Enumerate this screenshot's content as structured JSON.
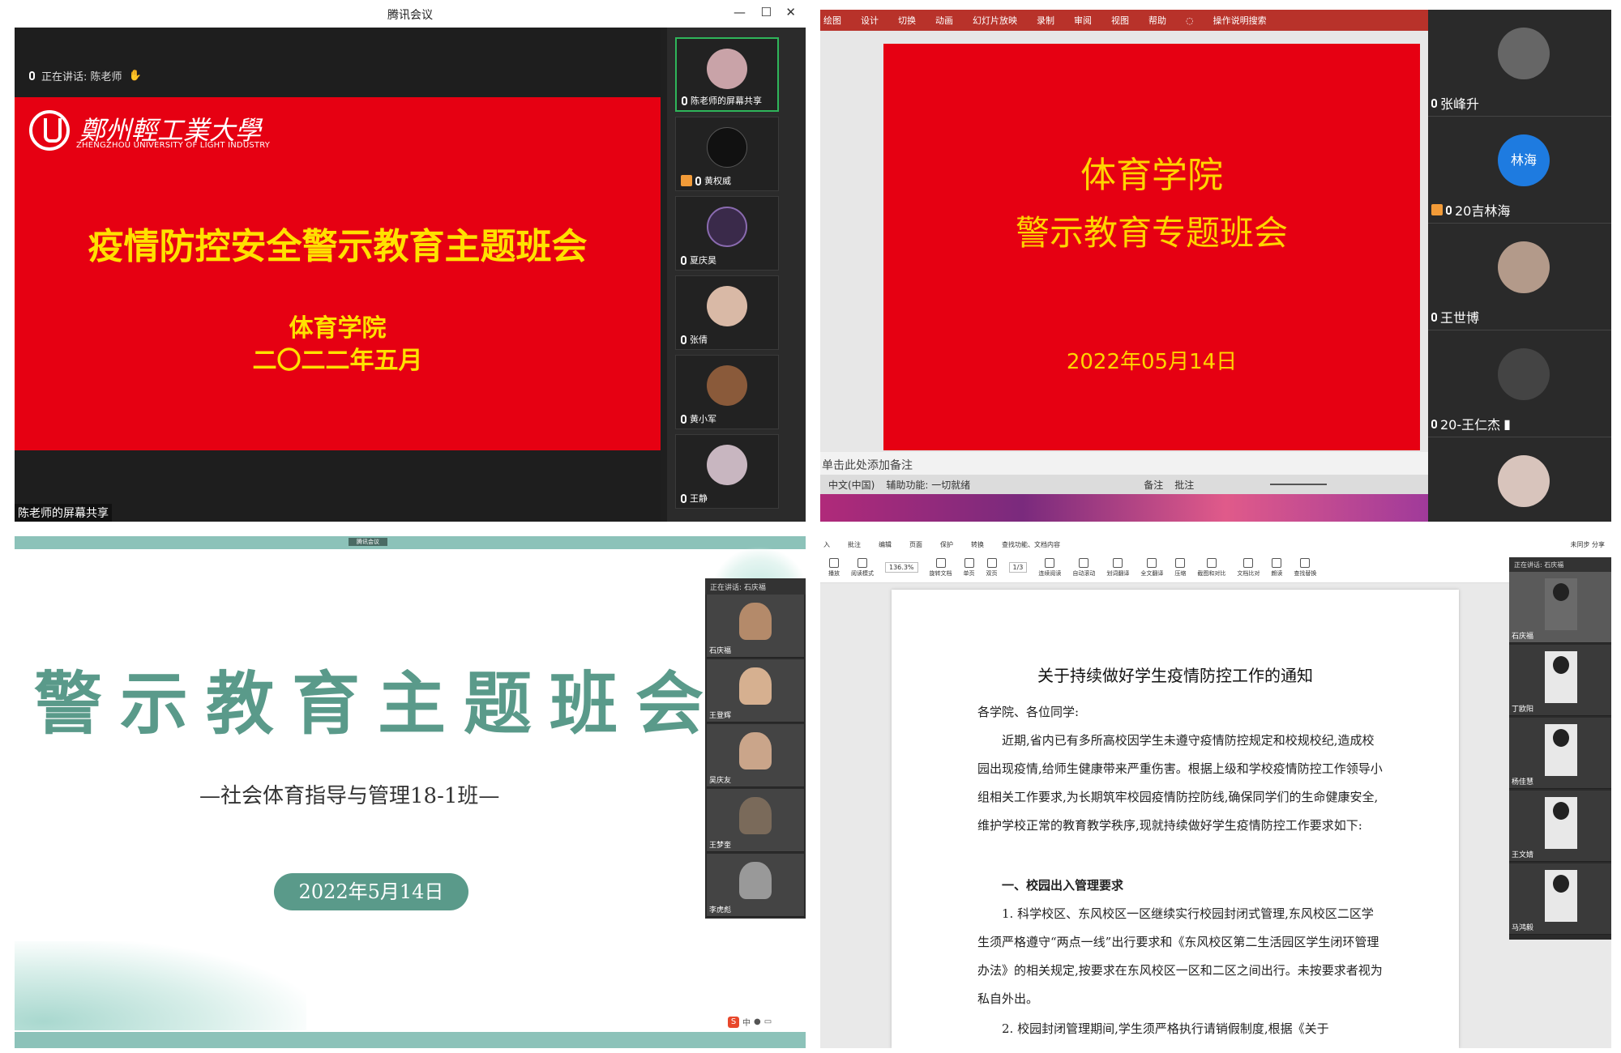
{
  "panel1": {
    "window_title": "腾讯会议",
    "speaking": "正在讲话: 陈老师",
    "slide": {
      "university_cn": "鄭州輕工業大學",
      "university_en": "ZHENGZHOU UNIVERSITY OF LIGHT INDUSTRY",
      "title": "疫情防控安全警示教育主题班会",
      "subtitle1": "体育学院",
      "subtitle2": "二〇二二年五月"
    },
    "share_label": "陈老师的屏幕共享",
    "participants": [
      "陈老师的屏幕共享",
      "黄权威",
      "夏庆昊",
      "张倩",
      "黄小军",
      "王静"
    ]
  },
  "panel2": {
    "ribbon": [
      "绘图",
      "设计",
      "切换",
      "动画",
      "幻灯片放映",
      "录制",
      "审阅",
      "视图",
      "帮助",
      "操作说明搜索"
    ],
    "slide": {
      "line1": "体育学院",
      "line2": "警示教育专题班会",
      "date": "2022年05月14日"
    },
    "notes_placeholder": "单击此处添加备注",
    "status": [
      "中文(中国)",
      "辅助功能: 一切就绪",
      "备注",
      "批注"
    ],
    "participants": [
      "张峰升",
      "20吉林海",
      "王世博",
      "20-王仁杰",
      ""
    ],
    "avatar_text": "林海"
  },
  "panel3": {
    "meeting_tag": "腾讯会议",
    "title": "警示教育主题班会",
    "subtitle": "—社会体育指导与管理18-1班—",
    "date": "2022年5月14日",
    "speaking": "正在讲话: 石庆福",
    "participants": [
      "石庆福",
      "王登辉",
      "吴庆友",
      "王梦奎",
      "李虎彪"
    ],
    "ime": "中"
  },
  "panel4": {
    "menu": [
      "入",
      "批注",
      "编辑",
      "页面",
      "保护",
      "转换",
      "查找功能、文档内容"
    ],
    "menu_right": "未同步  分享",
    "toolbar": [
      "播放",
      "阅读模式",
      "136.3%",
      "旋转文档",
      "单页",
      "双页",
      "连续阅读",
      "自动滚动",
      "划词翻译",
      "全文翻译",
      "压缩",
      "截图和对比",
      "文档比对",
      "朗读",
      "查找替换"
    ],
    "page_indicator": "1/3",
    "doc": {
      "title": "关于持续做好学生疫情防控工作的通知",
      "greeting": "各学院、各位同学:",
      "p1": "近期,省内已有多所高校因学生未遵守疫情防控规定和校规校纪,造成校园出现疫情,给师生健康带来严重伤害。根据上级和学校疫情防控工作领导小组相关工作要求,为长期筑牢校园疫情防控防线,确保同学们的生命健康安全,维护学校正常的教育教学秩序,现就持续做好学生疫情防控工作要求如下:",
      "h1": "一、校园出入管理要求",
      "p2": "1. 科学校区、东风校区一区继续实行校园封闭式管理,东风校区二区学生须严格遵守“两点一线”出行要求和《东风校区第二生活园区学生闭环管理办法》的相关规定,按要求在东风校区一区和二区之间出行。未按要求者视为私自外出。",
      "p3": "2. 校园封闭管理期间,学生须严格执行请销假制度,根据《关于"
    },
    "speaking": "正在讲话: 石庆福",
    "participants": [
      "石庆福",
      "丁欧阳",
      "杨佳慧",
      "王文婧",
      "马鸿毅"
    ]
  }
}
